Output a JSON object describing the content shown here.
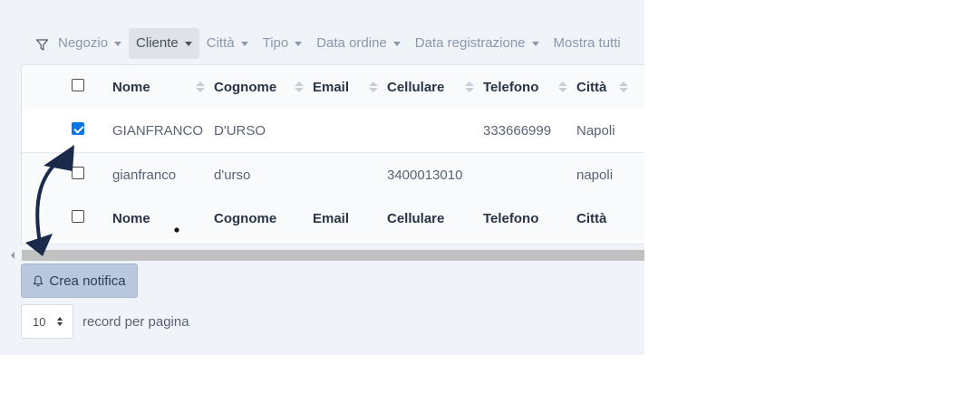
{
  "filters": {
    "items": [
      {
        "label": "Negozio",
        "active": false
      },
      {
        "label": "Cliente",
        "active": true
      },
      {
        "label": "Città",
        "active": false
      },
      {
        "label": "Tipo",
        "active": false
      },
      {
        "label": "Data ordine",
        "active": false
      },
      {
        "label": "Data registrazione",
        "active": false
      },
      {
        "label": "Mostra tutti",
        "active": false
      }
    ],
    "icon": "filter-icon"
  },
  "table": {
    "columns": [
      "Nome",
      "Cognome",
      "Email",
      "Cellulare",
      "Telefono",
      "Città"
    ],
    "rows": [
      {
        "checked": true,
        "nome": "GIANFRANCO",
        "cognome": "D'URSO",
        "email": "",
        "cellulare": "",
        "telefono": "333666999",
        "citta": "Napoli"
      },
      {
        "checked": false,
        "nome": "gianfranco",
        "cognome": "d'urso",
        "email": "",
        "cellulare": "3400013010",
        "telefono": "",
        "citta": "napoli"
      }
    ],
    "footer_columns": [
      "Nome",
      "Cognome",
      "Email",
      "Cellulare",
      "Telefono",
      "Città"
    ]
  },
  "actions": {
    "create_notification": "Crea notifica",
    "bell_icon": "bell-icon"
  },
  "pagination": {
    "page_size": "10",
    "label": "record per pagina"
  },
  "colors": {
    "background": "#f0f3f8",
    "checkbox_checked": "#0b75e6",
    "button_bg": "#b9c8de",
    "annotation": "#1b2a4a"
  }
}
